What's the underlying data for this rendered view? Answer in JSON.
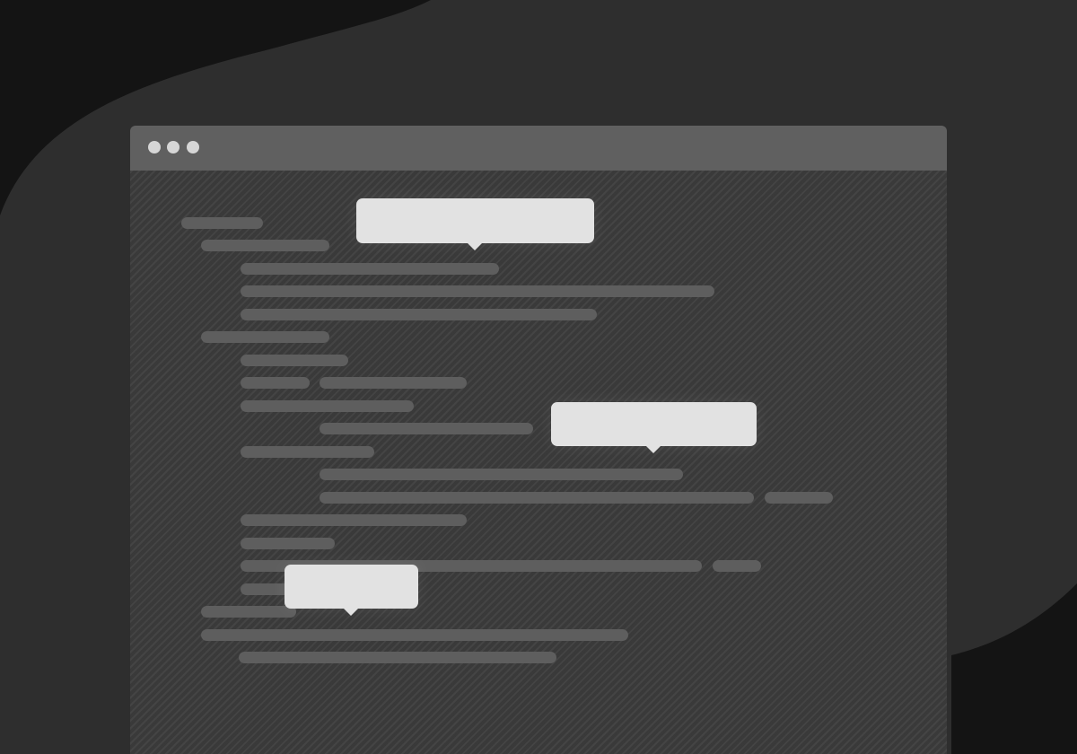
{
  "colors": {
    "background": "#141414",
    "backdrop_blob": "#2e2e2e",
    "window_body": "#3d3d3d",
    "title_bar": "#606060",
    "window_control_dots": "#d6d6d6",
    "code_lines": "#5e5e5e",
    "tooltips": "#e2e2e2"
  },
  "window": {
    "controls": [
      "close-dot-icon",
      "minimize-dot-icon",
      "maximize-dot-icon"
    ]
  },
  "tooltips": [
    {
      "text": ""
    },
    {
      "text": ""
    },
    {
      "text": ""
    }
  ]
}
